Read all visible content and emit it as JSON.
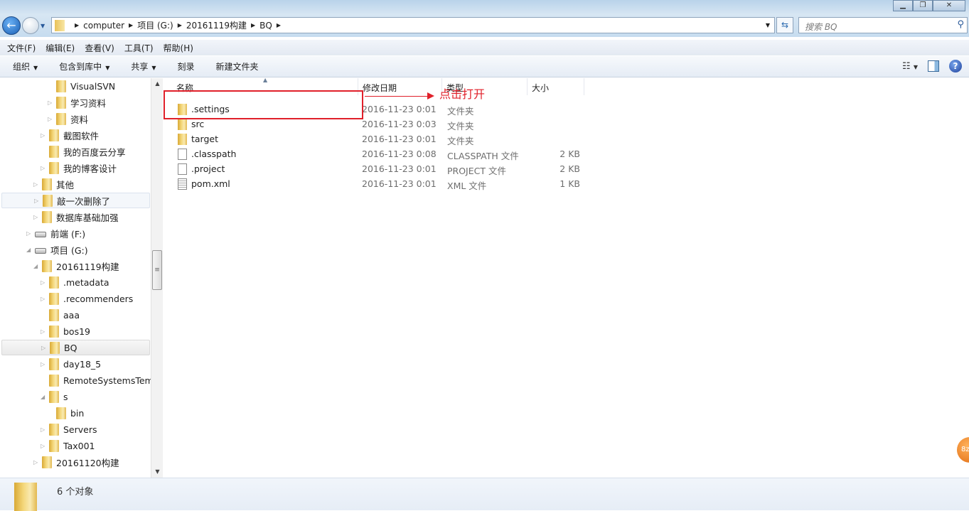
{
  "window": {
    "controls": [
      "minimize",
      "restore",
      "close"
    ]
  },
  "address": {
    "crumbs": [
      "computer",
      "项目 (G:)",
      "20161119构建",
      "BQ"
    ]
  },
  "search": {
    "placeholder": "搜索 BQ"
  },
  "menu": [
    "文件(F)",
    "编辑(E)",
    "查看(V)",
    "工具(T)",
    "帮助(H)"
  ],
  "toolbar": {
    "organize": "组织",
    "include": "包含到库中",
    "share": "共享",
    "burn": "刻录",
    "new_folder": "新建文件夹"
  },
  "tree": [
    {
      "label": "VisualSVN",
      "level": 4,
      "exp": "none",
      "icon": "folder"
    },
    {
      "label": "学习资料",
      "level": 4,
      "exp": "closed",
      "icon": "folder"
    },
    {
      "label": "资料",
      "level": 4,
      "exp": "closed",
      "icon": "folder"
    },
    {
      "label": "截图软件",
      "level": 3,
      "exp": "closed",
      "icon": "folder"
    },
    {
      "label": "我的百度云分享",
      "level": 3,
      "exp": "none",
      "icon": "folder"
    },
    {
      "label": "我的博客设计",
      "level": 3,
      "exp": "closed",
      "icon": "folder"
    },
    {
      "label": "其他",
      "level": 2,
      "exp": "closed",
      "icon": "folder"
    },
    {
      "label": "敲一次删除了",
      "level": 2,
      "exp": "closed",
      "icon": "folder",
      "hover": true
    },
    {
      "label": "数据库基础加强",
      "level": 2,
      "exp": "closed",
      "icon": "folder"
    },
    {
      "label": "前端 (F:)",
      "level": 1,
      "exp": "closed",
      "icon": "drive"
    },
    {
      "label": "项目 (G:)",
      "level": 1,
      "exp": "open",
      "icon": "drive"
    },
    {
      "label": "20161119构建",
      "level": 2,
      "exp": "open",
      "icon": "folder"
    },
    {
      "label": ".metadata",
      "level": 3,
      "exp": "closed",
      "icon": "folder"
    },
    {
      "label": ".recommenders",
      "level": 3,
      "exp": "closed",
      "icon": "folder"
    },
    {
      "label": "aaa",
      "level": 3,
      "exp": "none",
      "icon": "folder"
    },
    {
      "label": "bos19",
      "level": 3,
      "exp": "closed",
      "icon": "folder"
    },
    {
      "label": "BQ",
      "level": 3,
      "exp": "closed",
      "icon": "folder",
      "selected": true
    },
    {
      "label": "day18_5",
      "level": 3,
      "exp": "closed",
      "icon": "folder"
    },
    {
      "label": "RemoteSystemsTempF",
      "level": 3,
      "exp": "none",
      "icon": "folder"
    },
    {
      "label": "s",
      "level": 3,
      "exp": "open",
      "icon": "folder"
    },
    {
      "label": "bin",
      "level": 4,
      "exp": "none",
      "icon": "folder"
    },
    {
      "label": "Servers",
      "level": 3,
      "exp": "closed",
      "icon": "folder"
    },
    {
      "label": "Tax001",
      "level": 3,
      "exp": "closed",
      "icon": "folder"
    },
    {
      "label": "20161120构建",
      "level": 2,
      "exp": "closed",
      "icon": "folder"
    }
  ],
  "columns": {
    "name": "名称",
    "date": "修改日期",
    "type": "类型",
    "size": "大小"
  },
  "files": [
    {
      "name": ".settings",
      "date": "2016-11-23 0:01",
      "type": "文件夹",
      "size": "",
      "icon": "folder"
    },
    {
      "name": "src",
      "date": "2016-11-23 0:03",
      "type": "文件夹",
      "size": "",
      "icon": "folder"
    },
    {
      "name": "target",
      "date": "2016-11-23 0:01",
      "type": "文件夹",
      "size": "",
      "icon": "folder"
    },
    {
      "name": ".classpath",
      "date": "2016-11-23 0:08",
      "type": "CLASSPATH 文件",
      "size": "2 KB",
      "icon": "file"
    },
    {
      "name": ".project",
      "date": "2016-11-23 0:01",
      "type": "PROJECT 文件",
      "size": "2 KB",
      "icon": "file"
    },
    {
      "name": "pom.xml",
      "date": "2016-11-23 0:01",
      "type": "XML 文件",
      "size": "1 KB",
      "icon": "xml-file"
    }
  ],
  "annotation": {
    "text": "点击打开",
    "color": "#e0202a"
  },
  "status": {
    "count": "6 个对象"
  },
  "badge": {
    "text": "8z"
  }
}
